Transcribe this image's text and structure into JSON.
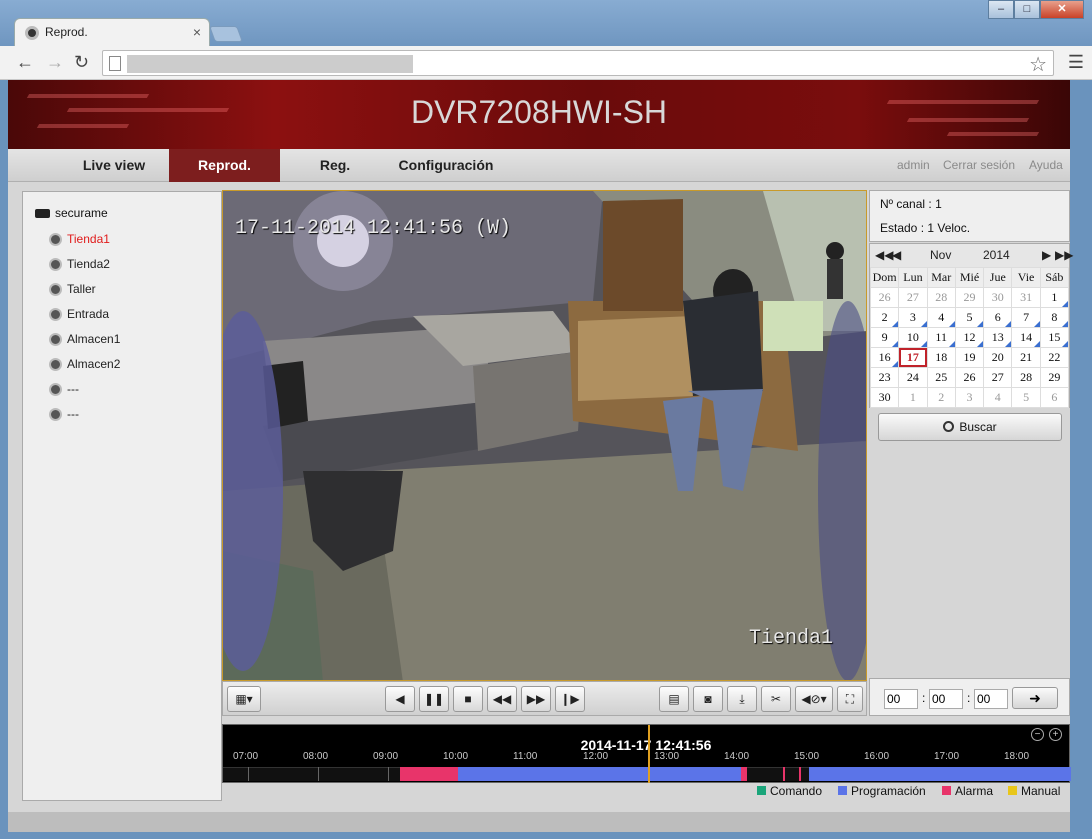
{
  "browser": {
    "tab_title": "Reprod.",
    "tab_close": "×",
    "win_min": "–",
    "win_max": "□",
    "win_close": "✕"
  },
  "banner": {
    "title": "DVR7208HWI-SH"
  },
  "nav": {
    "items": [
      "Live view",
      "Reprod.",
      "Reg.",
      "Configuración"
    ],
    "active": "Reprod.",
    "user": "admin",
    "logout": "Cerrar sesión",
    "help": "Ayuda"
  },
  "tree": {
    "root": "securame",
    "channels": [
      "Tienda1",
      "Tienda2",
      "Taller",
      "Entrada",
      "Almacen1",
      "Almacen2",
      "---",
      "---"
    ],
    "selected": "Tienda1"
  },
  "video": {
    "osd_timestamp": "17-11-2014 12:41:56 (W)",
    "osd_channel": "Tienda1"
  },
  "info": {
    "channel": "Nº canal : 1",
    "status": "Estado : 1 Veloc."
  },
  "calendar": {
    "month": "Nov",
    "year": "2014",
    "weekdays": [
      "Dom",
      "Lun",
      "Mar",
      "Mié",
      "Jue",
      "Vie",
      "Sáb"
    ],
    "days": [
      [
        "26",
        "27",
        "28",
        "29",
        "30",
        "31",
        "1"
      ],
      [
        "2",
        "3",
        "4",
        "5",
        "6",
        "7",
        "8"
      ],
      [
        "9",
        "10",
        "11",
        "12",
        "13",
        "14",
        "15"
      ],
      [
        "16",
        "17",
        "18",
        "19",
        "20",
        "21",
        "22"
      ],
      [
        "23",
        "24",
        "25",
        "26",
        "27",
        "28",
        "29"
      ],
      [
        "30",
        "1",
        "2",
        "3",
        "4",
        "5",
        "6"
      ]
    ],
    "selected": "17"
  },
  "search": {
    "label": "Buscar"
  },
  "time": {
    "hh": "00",
    "mm": "00",
    "ss": "00"
  },
  "timeline": {
    "datetime": "2014-11-17 12:41:56",
    "hours": [
      "07:00",
      "08:00",
      "09:00",
      "10:00",
      "11:00",
      "12:00",
      "13:00",
      "14:00",
      "15:00",
      "16:00",
      "17:00",
      "18:00"
    ]
  },
  "legend": [
    {
      "label": "Comando",
      "color": "#1aa57a"
    },
    {
      "label": "Programación",
      "color": "#5b74e8"
    },
    {
      "label": "Alarma",
      "color": "#e8346a"
    },
    {
      "label": "Manual",
      "color": "#e8c61a"
    }
  ]
}
